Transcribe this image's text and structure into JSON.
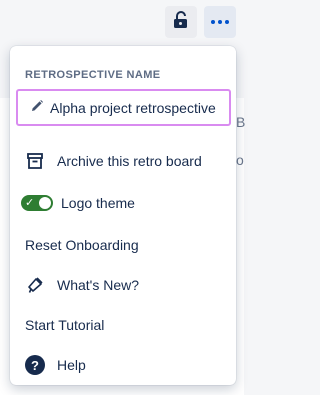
{
  "toolbar": {
    "lock_icon": "unlock-icon",
    "more_icon": "more-icon"
  },
  "menu": {
    "section_header": "RETROSPECTIVE NAME",
    "retro_name_value": "Alpha project retrospective",
    "items": {
      "archive": "Archive this retro board",
      "logo_theme": "Logo theme",
      "reset_onboarding": "Reset Onboarding",
      "whats_new": "What's New?",
      "start_tutorial": "Start Tutorial",
      "help": "Help"
    },
    "logo_theme_enabled": true
  },
  "colors": {
    "accent": "#0052cc",
    "focus_border": "#d98bf0",
    "toggle_on": "#2e7d32",
    "text": "#172b4d",
    "muted": "#5e6c84"
  }
}
